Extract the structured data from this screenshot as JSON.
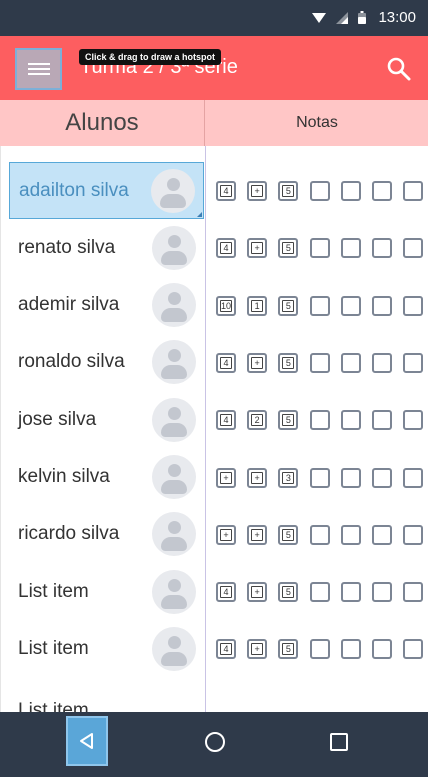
{
  "status_bar": {
    "time": "13:00"
  },
  "app_bar": {
    "title": "Turma 2 / 3ª série",
    "tooltip": "Click & drag to draw a hotspot",
    "menu_icon": "hamburger-icon",
    "search_icon": "search-icon"
  },
  "headers": {
    "students": "Alunos",
    "grades": "Notas"
  },
  "students": [
    {
      "name": "adailton silva",
      "selected": true,
      "grades": [
        "4",
        "+",
        "5",
        "",
        "",
        "",
        ""
      ]
    },
    {
      "name": "renato silva",
      "grades": [
        "4",
        "+",
        "5",
        "",
        "",
        "",
        ""
      ]
    },
    {
      "name": "ademir silva",
      "grades": [
        "10",
        "1",
        "5",
        "",
        "",
        "",
        ""
      ]
    },
    {
      "name": "ronaldo silva",
      "grades": [
        "4",
        "+",
        "5",
        "",
        "",
        "",
        ""
      ]
    },
    {
      "name": "jose silva",
      "grades": [
        "4",
        "2",
        "5",
        "",
        "",
        "",
        ""
      ]
    },
    {
      "name": "kelvin silva",
      "grades": [
        "+",
        "+",
        "3",
        "",
        "",
        "",
        ""
      ]
    },
    {
      "name": "ricardo silva",
      "grades": [
        "+",
        "+",
        "5",
        "",
        "",
        "",
        ""
      ]
    },
    {
      "name": "List item",
      "grades": [
        "4",
        "+",
        "5",
        "",
        "",
        "",
        ""
      ]
    },
    {
      "name": "List item",
      "grades": [
        "4",
        "+",
        "5",
        "",
        "",
        "",
        ""
      ]
    }
  ],
  "partial_item": "List item",
  "colors": {
    "app_bar": "#fd5e60",
    "header_bg": "#ffc6c6",
    "selected_bg": "#c4e3f7",
    "system_bar": "#2f3a4a"
  }
}
